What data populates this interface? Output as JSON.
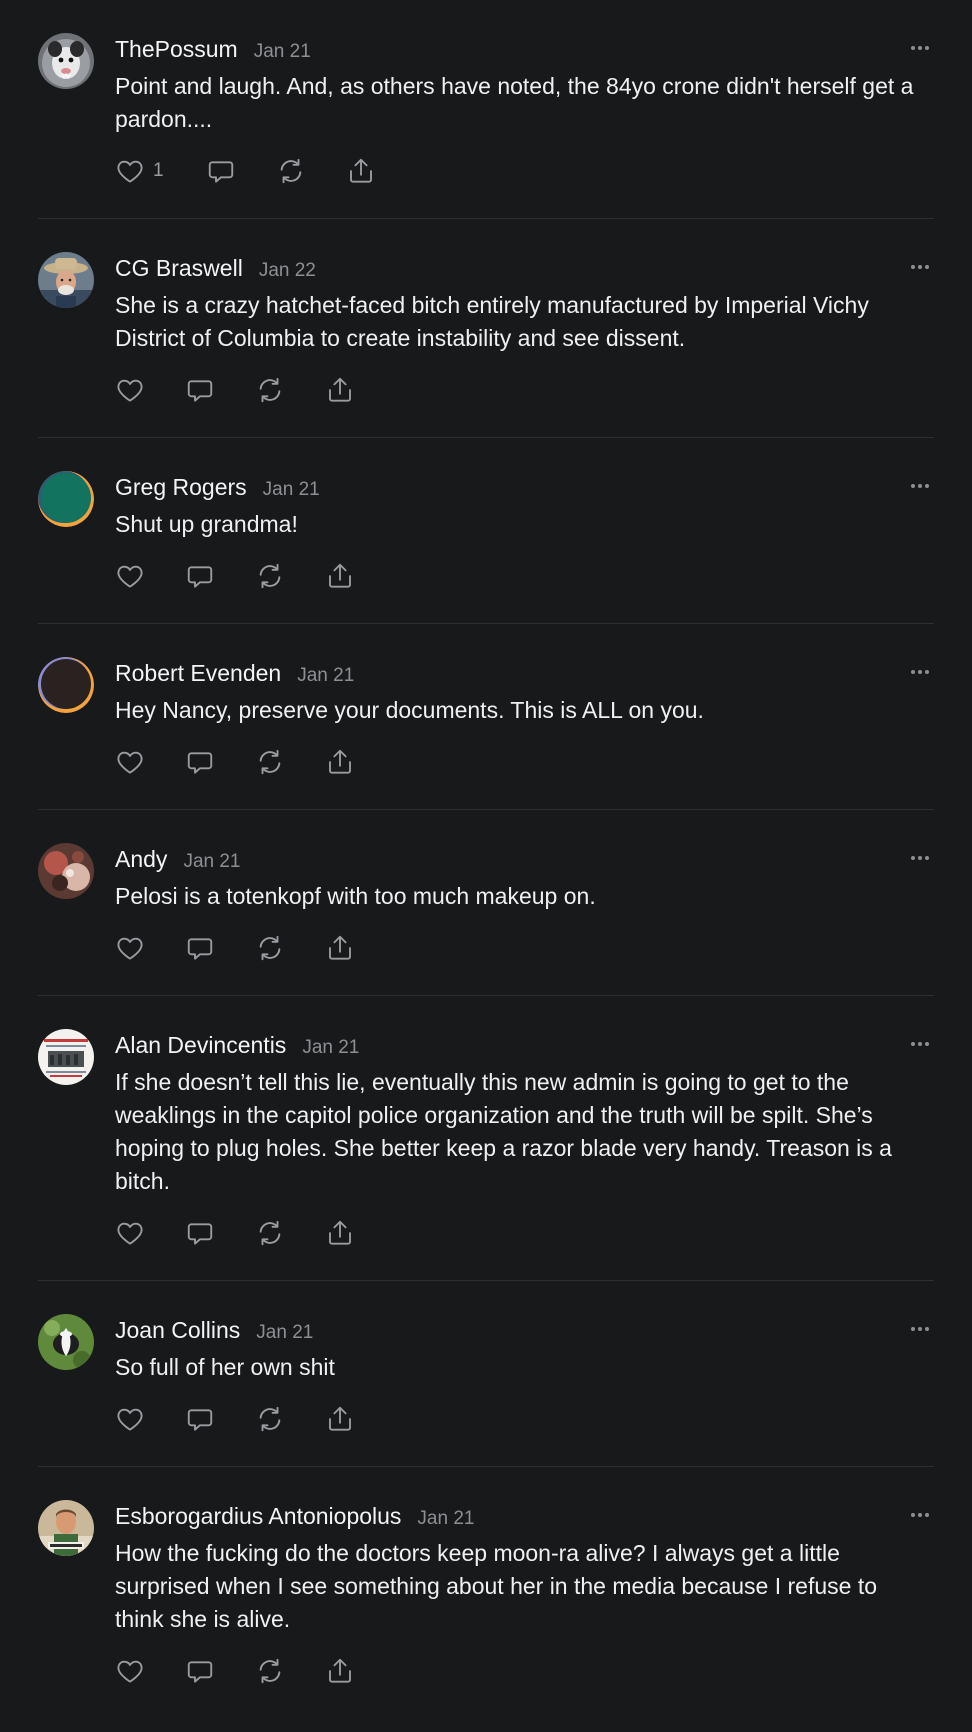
{
  "comments": [
    {
      "author": "ThePossum",
      "date": "Jan 21",
      "text": "Point and laugh. And, as others have noted, the 84yo crone didn't herself get a pardon....",
      "likes": "1",
      "avatar": "possum-photo"
    },
    {
      "author": "CG Braswell",
      "date": "Jan 22",
      "text": "She is a crazy hatchet-faced bitch entirely manufactured by Imperial Vichy District of Columbia to create instability and see dissent.",
      "likes": "",
      "avatar": "cowboy-photo"
    },
    {
      "author": "Greg Rogers",
      "date": "Jan 21",
      "text": "Shut up grandma!",
      "likes": "",
      "avatar": "default-green-orb"
    },
    {
      "author": "Robert Evenden",
      "date": "Jan 21",
      "text": "Hey Nancy, preserve your documents. This is ALL on you.",
      "likes": "",
      "avatar": "default-dark-orb"
    },
    {
      "author": "Andy",
      "date": "Jan 21",
      "text": "Pelosi is a totenkopf with too much makeup on.",
      "likes": "",
      "avatar": "abstract-photo"
    },
    {
      "author": "Alan Devincentis",
      "date": "Jan 21",
      "text": "If she doesn’t tell this lie, eventually this new admin is going to get to the weaklings in the capitol police organization and the truth will be spilt. She’s hoping to plug holes. She better keep a razor blade very handy. Treason is a bitch.",
      "likes": "",
      "avatar": "meme-photo"
    },
    {
      "author": "Joan Collins",
      "date": "Jan 21",
      "text": "So full of her own shit",
      "likes": "",
      "avatar": "skunk-photo"
    },
    {
      "author": "Esborogardius Antoniopolus",
      "date": "Jan 21",
      "text": "How the fucking do the doctors keep moon-ra alive? I always get a little surprised when I see something about her in the media because I refuse to think she is alive.",
      "likes": "",
      "avatar": "man-photo"
    }
  ],
  "icons": {
    "like": "heart-icon",
    "reply": "comment-bubble-icon",
    "restack": "restack-icon",
    "share": "share-icon",
    "more": "more-dots-icon"
  },
  "colors": {
    "background": "#18191b",
    "text": "#f0f0f1",
    "muted": "#8e8f94",
    "divider": "#2e2f33"
  }
}
